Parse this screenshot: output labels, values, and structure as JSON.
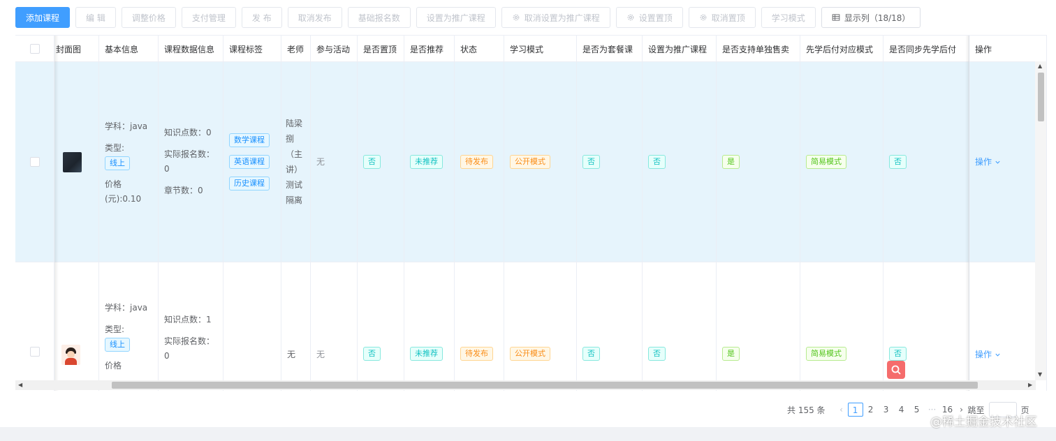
{
  "toolbar": {
    "buttons": [
      {
        "label": "添加课程"
      },
      {
        "label": "编 辑"
      },
      {
        "label": "调整价格"
      },
      {
        "label": "支付管理"
      },
      {
        "label": "发 布"
      },
      {
        "label": "取消发布"
      },
      {
        "label": "基础报名数"
      },
      {
        "label": "设置为推广课程"
      },
      {
        "label": "取消设置为推广课程",
        "icon": "gear-icon"
      },
      {
        "label": "设置置顶",
        "icon": "gear-icon"
      },
      {
        "label": "取消置顶",
        "icon": "gear-icon"
      },
      {
        "label": "学习模式"
      },
      {
        "label": "显示列（18/18）",
        "icon": "table-icon"
      }
    ]
  },
  "table": {
    "columns": [
      "封面图",
      "基本信息",
      "课程数据信息",
      "课程标签",
      "老师",
      "参与活动",
      "是否置顶",
      "是否推荐",
      "状态",
      "学习模式",
      "是否为套餐课",
      "设置为推广课程",
      "是否支持单独售卖",
      "先学后付对应模式",
      "是否同步先学后付",
      "操作"
    ],
    "rows": [
      {
        "basic": {
          "subject": "学科：java",
          "type_label": "类型:",
          "type_tag": "线上",
          "price": "价格(元):0.10"
        },
        "data_info": {
          "knowledge": "知识点数：0",
          "enrolled": "实际报名数：0",
          "chapters": "章节数：0"
        },
        "tags": [
          "数学课程",
          "英语课程",
          "历史课程"
        ],
        "teacher": "陆梁捌（主讲）测试隔离",
        "activity": "无",
        "pinned": "否",
        "recommended": "未推荐",
        "status": "待发布",
        "study_mode": "公开模式",
        "bundle": "否",
        "promoted": "否",
        "sold_separately": "是",
        "pay_later_mode": "简易模式",
        "sync_pay_later": "否",
        "action": "操作"
      },
      {
        "basic": {
          "subject": "学科：java",
          "type_label": "类型:",
          "type_tag": "线上",
          "price": "价格"
        },
        "data_info": {
          "knowledge": "知识点数：1",
          "enrolled": "实际报名数：0"
        },
        "tags": [],
        "teacher": "无",
        "activity": "无",
        "pinned": "否",
        "recommended": "未推荐",
        "status": "待发布",
        "study_mode": "公开模式",
        "bundle": "否",
        "promoted": "否",
        "sold_separately": "是",
        "pay_later_mode": "简易模式",
        "sync_pay_later": "否",
        "action": "操作"
      }
    ]
  },
  "pagination": {
    "total": "共 155 条",
    "pages": [
      "1",
      "2",
      "3",
      "4",
      "5"
    ],
    "ellipsis": "···",
    "last": "16",
    "current": "1",
    "jump_prefix": "跳至",
    "jump_suffix": "页"
  },
  "watermark": "@稀土掘金技术社区",
  "colors": {
    "primary": "#409eff",
    "highlight_row": "#e6f4fc",
    "danger": "#f56c6c"
  }
}
